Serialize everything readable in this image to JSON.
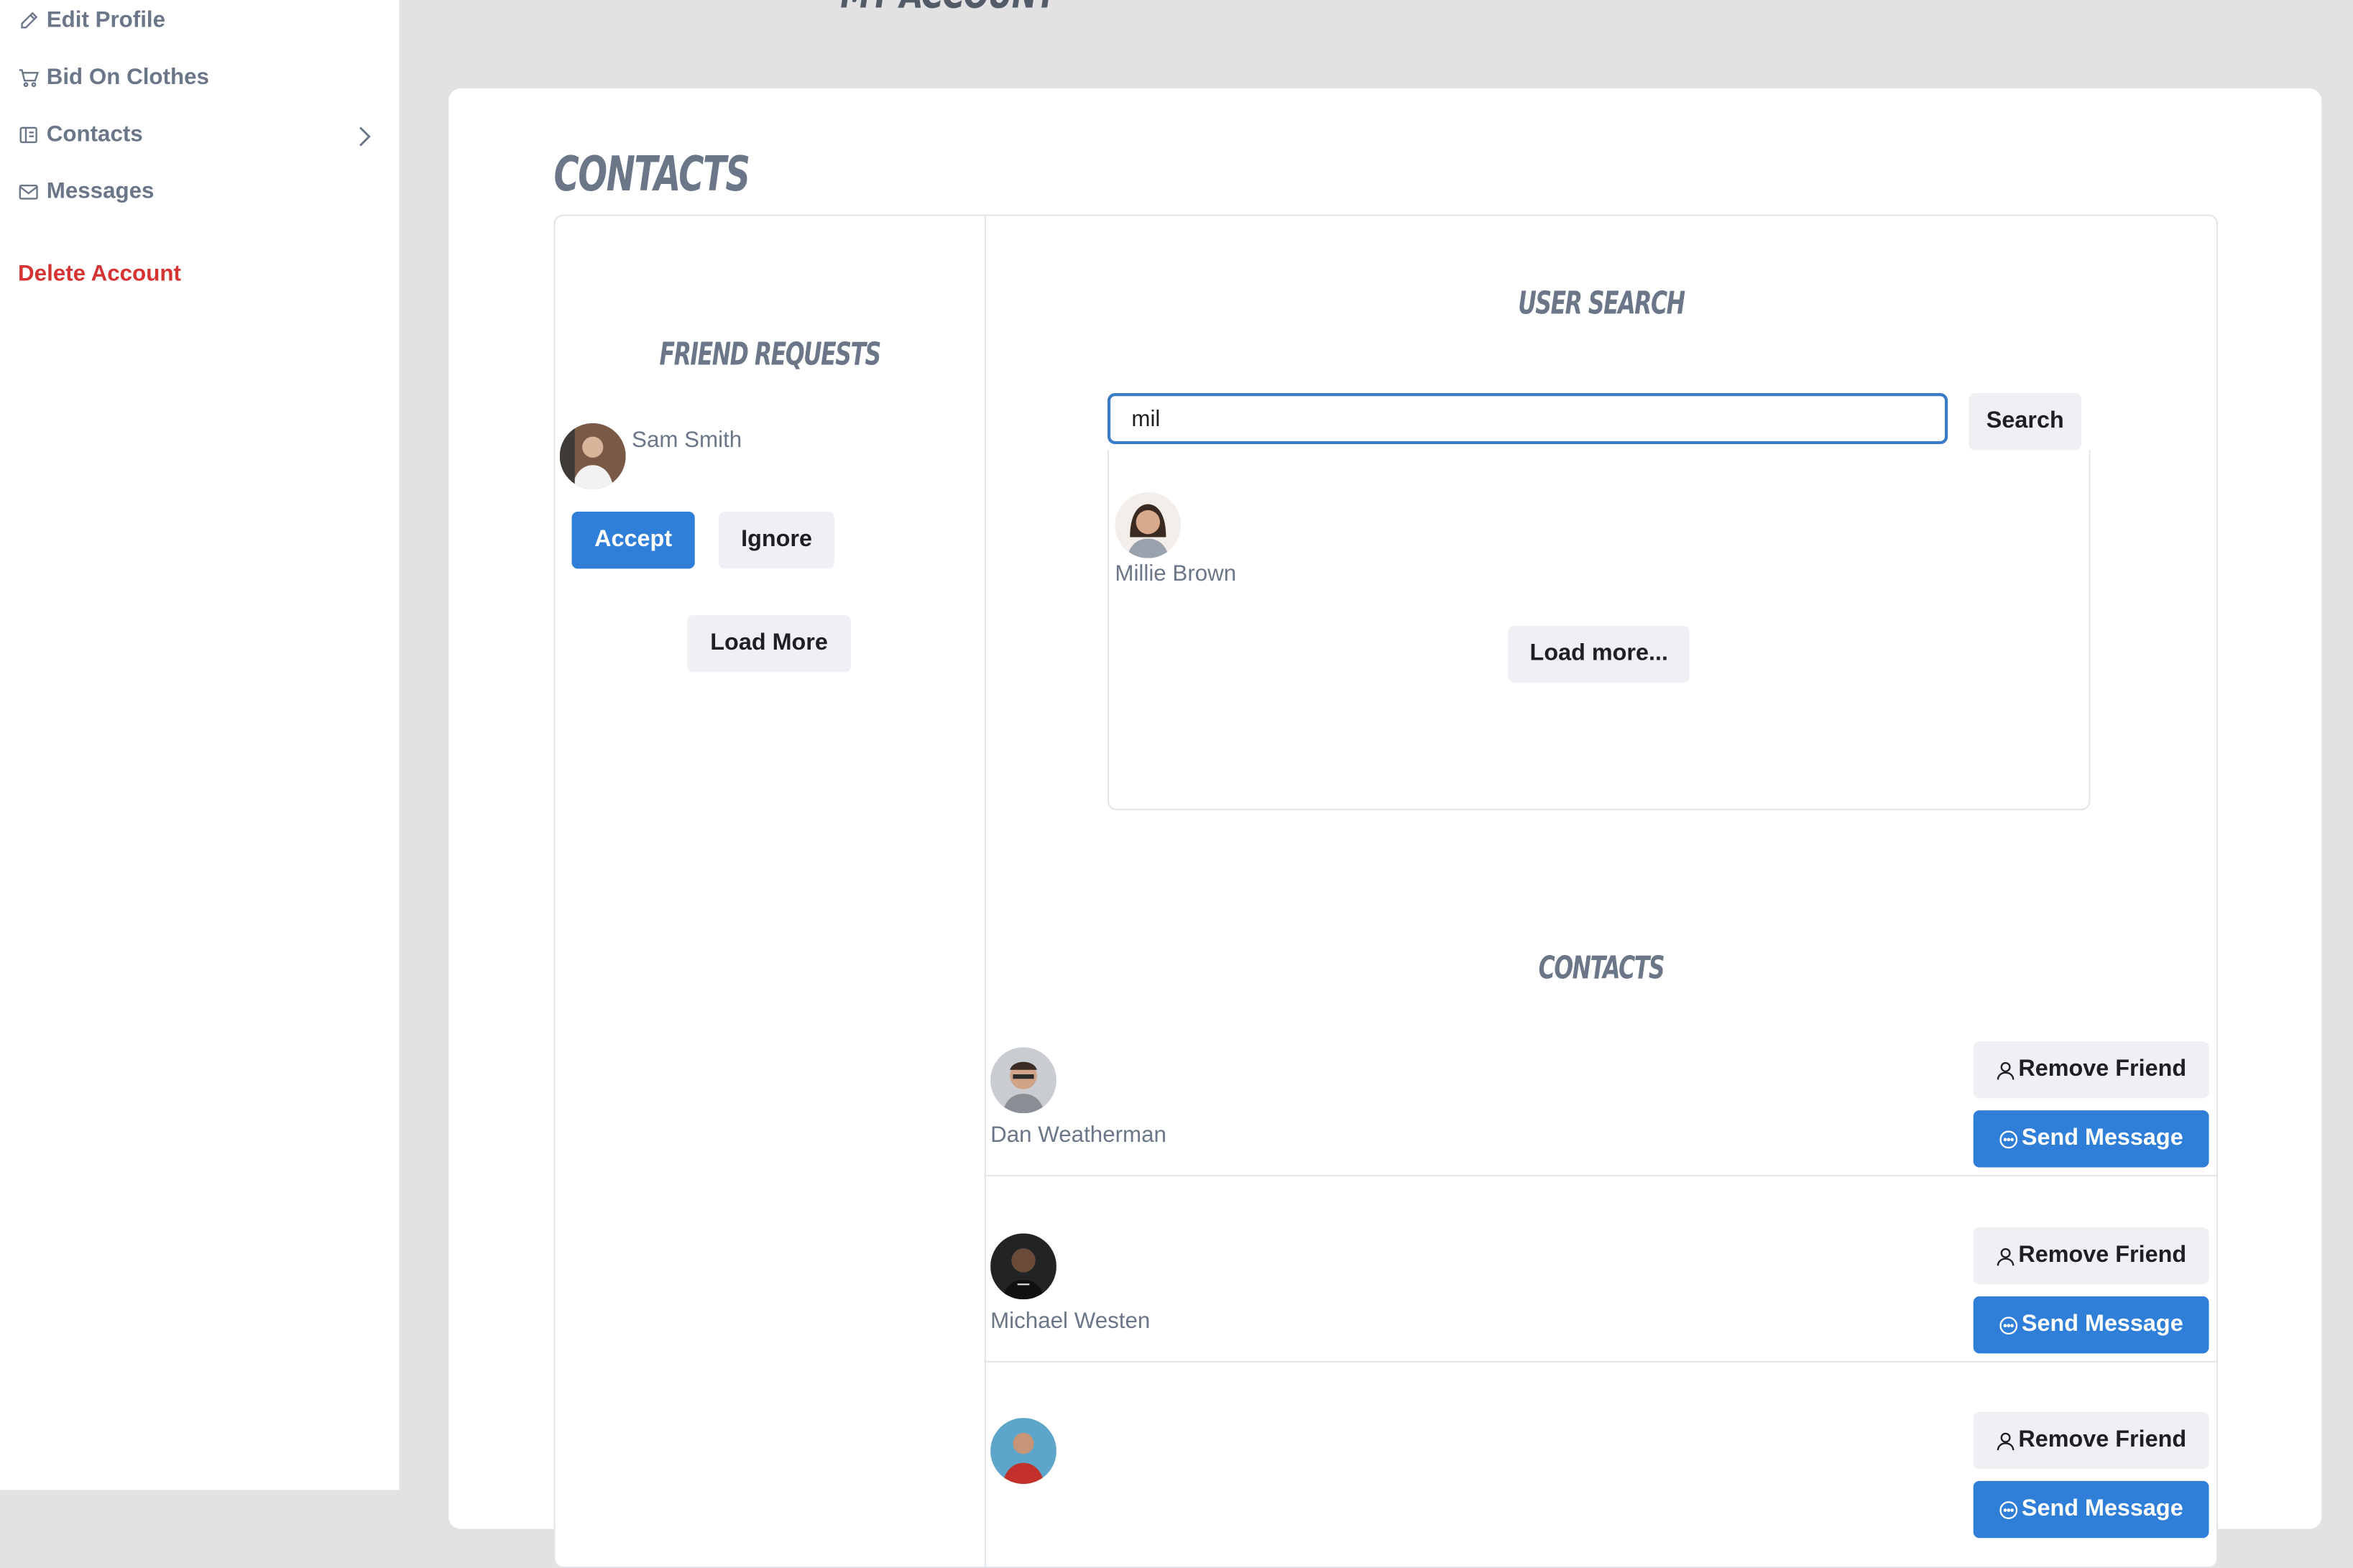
{
  "sidebar": {
    "items": [
      {
        "label": "Edit Profile",
        "icon": "pencil-icon"
      },
      {
        "label": "Bid On Clothes",
        "icon": "cart-icon"
      },
      {
        "label": "Contacts",
        "icon": "book-icon"
      },
      {
        "label": "Messages",
        "icon": "envelope-icon"
      }
    ],
    "delete_label": "Delete Account"
  },
  "page": {
    "heading_peek": "MY ACCOUNT",
    "title": "Contacts"
  },
  "friend_requests": {
    "title": "Friend Requests",
    "items": [
      {
        "name": "Sam Smith"
      }
    ],
    "accept_label": "Accept",
    "ignore_label": "Ignore",
    "load_more_label": "Load More"
  },
  "user_search": {
    "title": "User Search",
    "query": "mil",
    "button_label": "Search",
    "results": [
      {
        "name": "Millie Brown"
      }
    ],
    "load_more_label": "Load more..."
  },
  "contacts": {
    "title": "Contacts",
    "items": [
      {
        "name": "Dan Weatherman"
      },
      {
        "name": "Michael Westen"
      },
      {
        "name": ""
      }
    ],
    "remove_label": "Remove Friend",
    "message_label": "Send Message"
  },
  "colors": {
    "primary": "#2f7ed8",
    "danger": "#d63333",
    "muted_text": "#6b7688",
    "background": "#e2e2e2"
  }
}
